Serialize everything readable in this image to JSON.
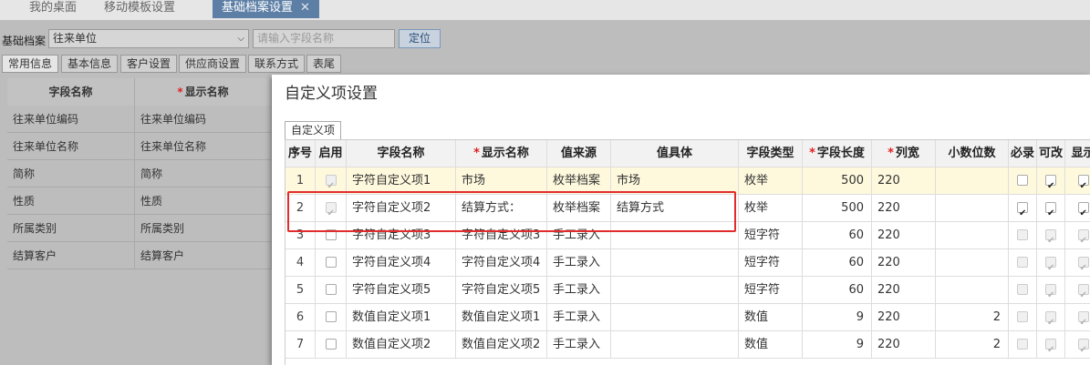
{
  "top_tabs": [
    {
      "label": "我的桌面"
    },
    {
      "label": "移动模板设置"
    },
    {
      "label": "基础档案设置",
      "close": "✕"
    }
  ],
  "toolbar": {
    "label": "基础档案",
    "select_value": "往来单位",
    "search_placeholder": "请输入字段名称",
    "locate_label": "定位"
  },
  "subtabs": [
    "常用信息",
    "基本信息",
    "客户设置",
    "供应商设置",
    "联系方式",
    "表尾"
  ],
  "left_table": {
    "headers": [
      "字段名称",
      "显示名称"
    ],
    "rows": [
      [
        "往来单位编码",
        "往来单位编码"
      ],
      [
        "往来单位名称",
        "往来单位名称"
      ],
      [
        "简称",
        "简称"
      ],
      [
        "性质",
        "性质"
      ],
      [
        "所属类别",
        "所属类别"
      ],
      [
        "结算客户",
        "结算客户"
      ]
    ]
  },
  "modal": {
    "title": "自定义项设置",
    "tab": "自定义项",
    "headers": [
      "序号",
      "启用",
      "字段名称",
      "显示名称",
      "值来源",
      "值具体",
      "字段类型",
      "字段长度",
      "列宽",
      "小数位数",
      "必录",
      "可改",
      "显示"
    ],
    "rows": [
      {
        "no": "1",
        "enabled": true,
        "field": "字符自定义项1",
        "display": "市场",
        "source": "枚举档案",
        "value": "市场",
        "type": "枚举",
        "length": "500",
        "width": "220",
        "decimals": "",
        "required": false,
        "editable": true,
        "show": true
      },
      {
        "no": "2",
        "enabled": true,
        "field": "字符自定义项2",
        "display": "结算方式：",
        "source": "枚举档案",
        "value": "结算方式",
        "type": "枚举",
        "length": "500",
        "width": "220",
        "decimals": "",
        "required": true,
        "editable": true,
        "show": true
      },
      {
        "no": "3",
        "enabled": false,
        "field": "字符自定义项3",
        "display": "字符自定义项3",
        "source": "手工录入",
        "value": "",
        "type": "短字符",
        "length": "60",
        "width": "220",
        "decimals": "",
        "required": false,
        "editable": true,
        "show": true
      },
      {
        "no": "4",
        "enabled": false,
        "field": "字符自定义项4",
        "display": "字符自定义项4",
        "source": "手工录入",
        "value": "",
        "type": "短字符",
        "length": "60",
        "width": "220",
        "decimals": "",
        "required": false,
        "editable": true,
        "show": true
      },
      {
        "no": "5",
        "enabled": false,
        "field": "字符自定义项5",
        "display": "字符自定义项5",
        "source": "手工录入",
        "value": "",
        "type": "短字符",
        "length": "60",
        "width": "220",
        "decimals": "",
        "required": false,
        "editable": true,
        "show": true
      },
      {
        "no": "6",
        "enabled": false,
        "field": "数值自定义项1",
        "display": "数值自定义项1",
        "source": "手工录入",
        "value": "",
        "type": "数值",
        "length": "9",
        "width": "220",
        "decimals": "2",
        "required": false,
        "editable": true,
        "show": true
      },
      {
        "no": "7",
        "enabled": false,
        "field": "数值自定义项2",
        "display": "数值自定义项2",
        "source": "手工录入",
        "value": "",
        "type": "数值",
        "length": "9",
        "width": "220",
        "decimals": "2",
        "required": false,
        "editable": true,
        "show": true
      }
    ]
  }
}
